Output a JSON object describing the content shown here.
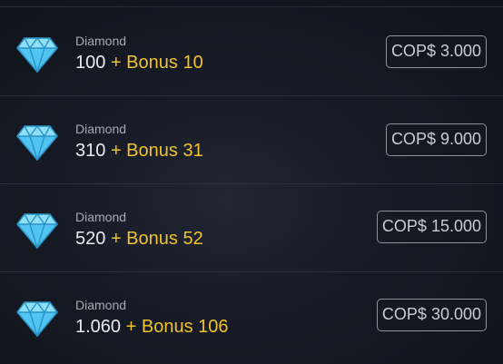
{
  "accent_bonus_color": "#f2c229",
  "gem_color": "#52c4f2",
  "items": [
    {
      "icon": "diamond-icon",
      "label": "Diamond",
      "amount": "100",
      "bonus": "+ Bonus 10",
      "price": "COP$ 3.000"
    },
    {
      "icon": "diamond-icon",
      "label": "Diamond",
      "amount": "310",
      "bonus": "+ Bonus 31",
      "price": "COP$ 9.000"
    },
    {
      "icon": "diamond-icon",
      "label": "Diamond",
      "amount": "520",
      "bonus": "+ Bonus 52",
      "price": "COP$ 15.000"
    },
    {
      "icon": "diamond-icon",
      "label": "Diamond",
      "amount": "1.060",
      "bonus": "+ Bonus 106",
      "price": "COP$ 30.000"
    }
  ]
}
